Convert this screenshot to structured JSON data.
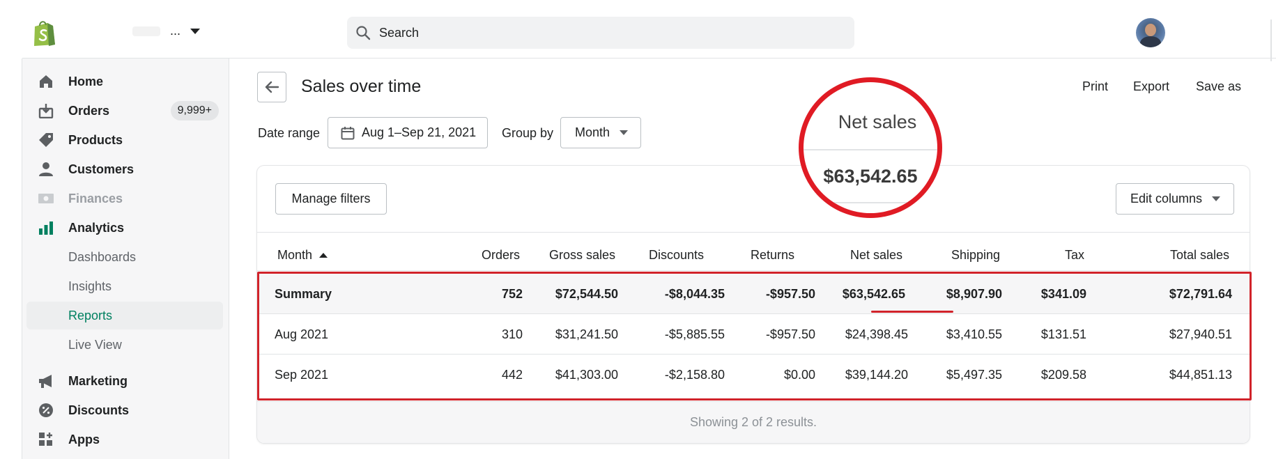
{
  "topbar": {
    "store_name": "...",
    "search_placeholder": "Search"
  },
  "sidebar": {
    "items": [
      {
        "label": "Home",
        "icon": "home-icon"
      },
      {
        "label": "Orders",
        "icon": "orders-icon",
        "badge": "9,999+"
      },
      {
        "label": "Products",
        "icon": "tag-icon"
      },
      {
        "label": "Customers",
        "icon": "person-icon"
      },
      {
        "label": "Finances",
        "icon": "finances-icon",
        "disabled": true
      },
      {
        "label": "Analytics",
        "icon": "bar-chart-icon"
      }
    ],
    "analytics_sub": [
      {
        "label": "Dashboards"
      },
      {
        "label": "Insights"
      },
      {
        "label": "Reports",
        "active": true
      },
      {
        "label": "Live View"
      }
    ],
    "items2": [
      {
        "label": "Marketing",
        "icon": "megaphone-icon"
      },
      {
        "label": "Discounts",
        "icon": "discount-icon"
      },
      {
        "label": "Apps",
        "icon": "apps-icon"
      }
    ]
  },
  "page": {
    "title": "Sales over time",
    "actions": {
      "print": "Print",
      "export": "Export",
      "save_as": "Save as"
    },
    "date_range_label": "Date range",
    "date_range_value": "Aug 1–Sep 21, 2021",
    "group_by_label": "Group by",
    "group_by_value": "Month"
  },
  "card": {
    "manage_filters": "Manage filters",
    "edit_columns": "Edit columns",
    "columns": [
      "Month",
      "Orders",
      "Gross sales",
      "Discounts",
      "Returns",
      "Net sales",
      "Shipping",
      "Tax",
      "Total sales"
    ],
    "rows": [
      {
        "month": "Summary",
        "orders": "752",
        "gross": "$72,544.50",
        "discounts": "-$8,044.35",
        "returns": "-$957.50",
        "net": "$63,542.65",
        "shipping": "$8,907.90",
        "tax": "$341.09",
        "total": "$72,791.64"
      },
      {
        "month": "Aug 2021",
        "orders": "310",
        "gross": "$31,241.50",
        "discounts": "-$5,885.55",
        "returns": "-$957.50",
        "net": "$24,398.45",
        "shipping": "$3,410.55",
        "tax": "$131.51",
        "total": "$27,940.51"
      },
      {
        "month": "Sep 2021",
        "orders": "442",
        "gross": "$41,303.00",
        "discounts": "-$2,158.80",
        "returns": "$0.00",
        "net": "$39,144.20",
        "shipping": "$5,497.35",
        "tax": "$209.58",
        "total": "$44,851.13"
      }
    ],
    "footer": "Showing 2 of 2 results."
  },
  "zoom": {
    "label": "Net sales",
    "value": "$63,542.65"
  },
  "colors": {
    "accent": "#008060",
    "annotation": "#d1232a",
    "brand_logo": "#95bf47"
  }
}
